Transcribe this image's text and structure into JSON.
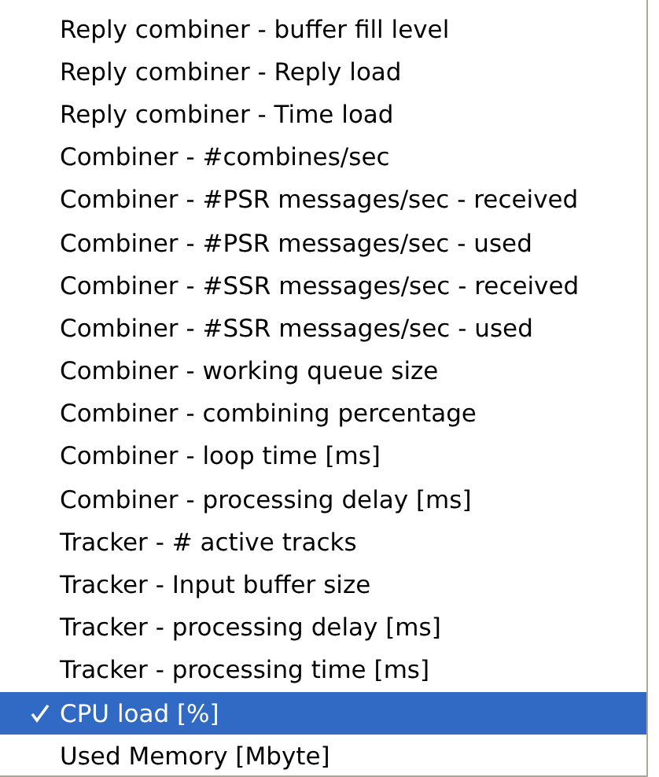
{
  "menu": {
    "items": [
      {
        "label": "Reply combiner - buffer fill level",
        "checked": false,
        "selected": false
      },
      {
        "label": "Reply combiner - Reply load",
        "checked": false,
        "selected": false
      },
      {
        "label": "Reply combiner - Time load",
        "checked": false,
        "selected": false
      },
      {
        "label": "Combiner - #combines/sec",
        "checked": false,
        "selected": false
      },
      {
        "label": "Combiner - #PSR messages/sec - received",
        "checked": false,
        "selected": false
      },
      {
        "label": "Combiner - #PSR messages/sec - used",
        "checked": false,
        "selected": false
      },
      {
        "label": "Combiner - #SSR messages/sec - received",
        "checked": false,
        "selected": false
      },
      {
        "label": "Combiner - #SSR messages/sec - used",
        "checked": false,
        "selected": false
      },
      {
        "label": "Combiner - working queue size",
        "checked": false,
        "selected": false
      },
      {
        "label": "Combiner - combining percentage",
        "checked": false,
        "selected": false
      },
      {
        "label": "Combiner - loop time [ms]",
        "checked": false,
        "selected": false
      },
      {
        "label": "Combiner - processing delay [ms]",
        "checked": false,
        "selected": false
      },
      {
        "label": "Tracker - # active tracks",
        "checked": false,
        "selected": false
      },
      {
        "label": "Tracker - Input buffer size",
        "checked": false,
        "selected": false
      },
      {
        "label": "Tracker - processing delay [ms]",
        "checked": false,
        "selected": false
      },
      {
        "label": "Tracker - processing time [ms]",
        "checked": false,
        "selected": false
      },
      {
        "label": "CPU load [%]",
        "checked": true,
        "selected": true
      },
      {
        "label": "Used Memory [Mbyte]",
        "checked": false,
        "selected": false
      }
    ]
  }
}
